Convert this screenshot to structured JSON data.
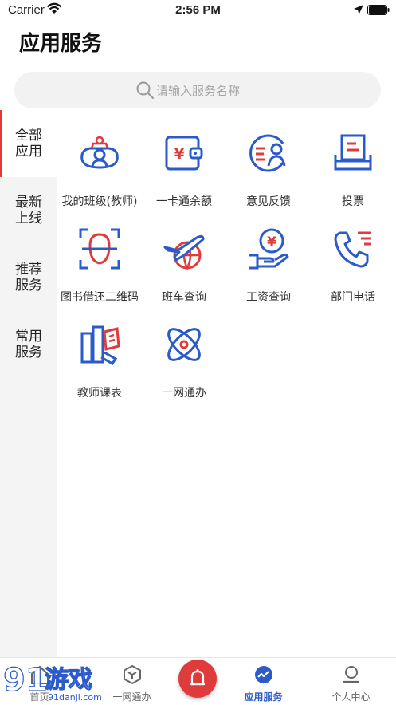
{
  "status_bar": {
    "carrier": "Carrier",
    "time": "2:56 PM"
  },
  "page": {
    "title": "应用服务"
  },
  "search": {
    "placeholder": "请输入服务名称"
  },
  "sidebar": {
    "tabs": [
      {
        "label": "全部应用",
        "active": true
      },
      {
        "label": "最新上线",
        "active": false
      },
      {
        "label": "推荐服务",
        "active": false
      },
      {
        "label": "常用服务",
        "active": false
      }
    ]
  },
  "services": [
    {
      "label": "我的班级(教师)",
      "icon": "class-icon"
    },
    {
      "label": "一卡通余额",
      "icon": "wallet-icon"
    },
    {
      "label": "意见反馈",
      "icon": "feedback-icon"
    },
    {
      "label": "投票",
      "icon": "vote-icon"
    },
    {
      "label": "图书借还二维码",
      "icon": "face-scan-icon"
    },
    {
      "label": "班车查询",
      "icon": "airplane-globe-icon"
    },
    {
      "label": "工资查询",
      "icon": "salary-icon"
    },
    {
      "label": "部门电话",
      "icon": "phone-icon"
    },
    {
      "label": "教师课表",
      "icon": "timetable-icon"
    },
    {
      "label": "一网通办",
      "icon": "orbit-icon"
    }
  ],
  "tab_bar": {
    "tabs": [
      {
        "label": "首页",
        "icon": "home-icon"
      },
      {
        "label": "一网通办",
        "icon": "hexagon-icon"
      },
      {
        "label": "",
        "icon": "bell-icon"
      },
      {
        "label": "应用服务",
        "icon": "app-service-icon",
        "active": true
      },
      {
        "label": "个人中心",
        "icon": "profile-icon"
      }
    ]
  },
  "watermark": {
    "text": "游戏",
    "number": "91",
    "site": "91danji.com"
  },
  "colors": {
    "accent_red": "#e03b3b",
    "accent_blue": "#2b5bc9"
  }
}
